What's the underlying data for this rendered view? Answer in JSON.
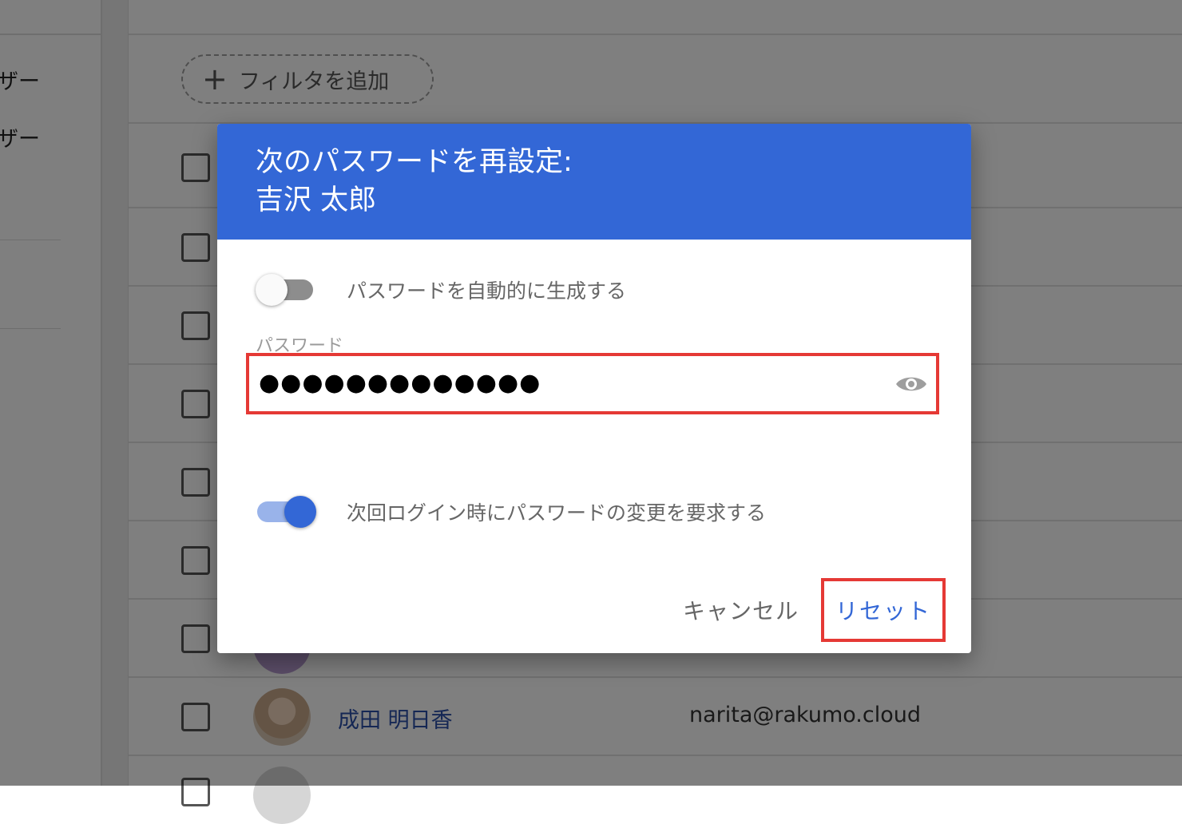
{
  "background": {
    "sidebar_items": [
      "ザー",
      "ザー"
    ],
    "filter_button": {
      "icon": "plus-icon",
      "label": "フィルタを追加"
    },
    "visible_user": {
      "name": "成田 明日香",
      "email": "narita@rakumo.cloud"
    }
  },
  "dialog": {
    "title_line1": "次のパスワードを再設定:",
    "title_line2": "吉沢 太郎",
    "auto_generate_label": "パスワードを自動的に生成する",
    "auto_generate_on": false,
    "password_label": "パスワード",
    "password_masked": "●●●●●●●●●●●●●",
    "show_password_icon": "eye-icon",
    "require_change_label": "次回ログイン時にパスワードの変更を要求する",
    "require_change_on": true,
    "cancel_label": "キャンセル",
    "reset_label": "リセット"
  },
  "colors": {
    "header_blue": "#3367d6",
    "highlight_red": "#e53935",
    "link_blue": "#2a4fa8"
  }
}
